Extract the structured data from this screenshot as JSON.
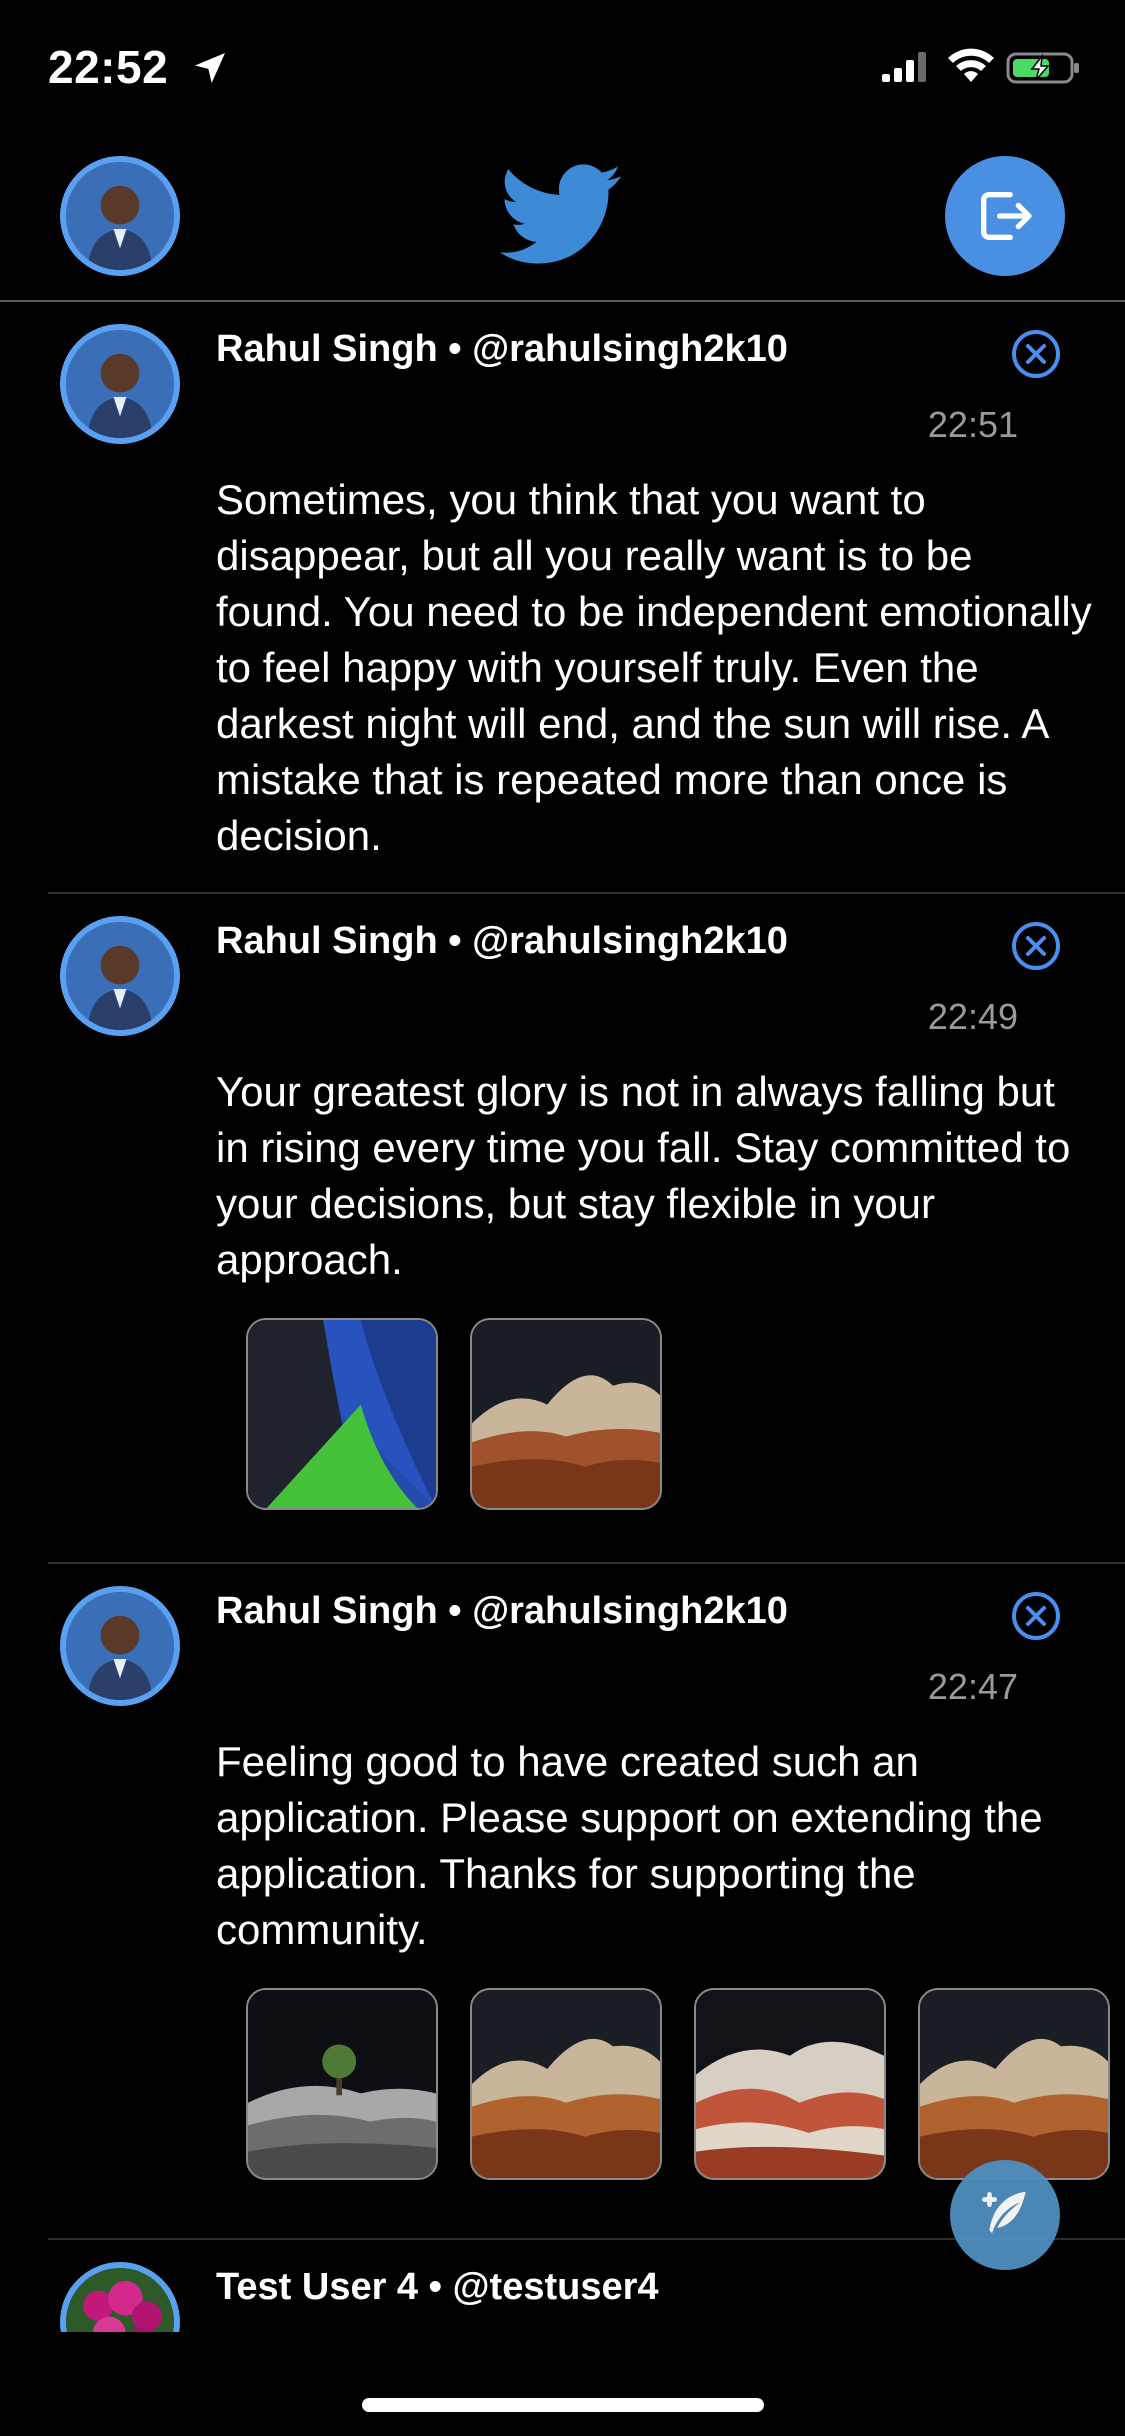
{
  "status_bar": {
    "time": "22:52"
  },
  "header": {
    "logo_icon": "twitter-bird-icon",
    "logout_icon": "logout-icon",
    "accent_color": "#4a90e2"
  },
  "tweets": [
    {
      "author": "Rahul Singh • @rahulsingh2k10",
      "time": "22:51",
      "text": "Sometimes, you think that you want to disappear, but all you really want is to be found. You need to be independent emotionally to feel happy with yourself truly. Even the darkest night will end, and the sun will rise. A mistake that is repeated more than once is decision.",
      "media": []
    },
    {
      "author": "Rahul Singh • @rahulsingh2k10",
      "time": "22:49",
      "text": "Your greatest glory is not in always falling but in rising every time you fall. Stay committed to your decisions, but stay flexible in your approach.",
      "media": [
        "abstract-wallpaper",
        "desert-rock"
      ]
    },
    {
      "author": "Rahul Singh • @rahulsingh2k10",
      "time": "22:47",
      "text": "Feeling good to have created such an application. Please support on extending the application. Thanks for supporting the community.",
      "media": [
        "night-tree",
        "desert-rock",
        "red-rock",
        "desert-rock"
      ]
    },
    {
      "author": "Test User 4 • @testuser4",
      "time": "",
      "text": "",
      "media": []
    }
  ],
  "fab": {
    "icon": "compose-feather-icon"
  }
}
